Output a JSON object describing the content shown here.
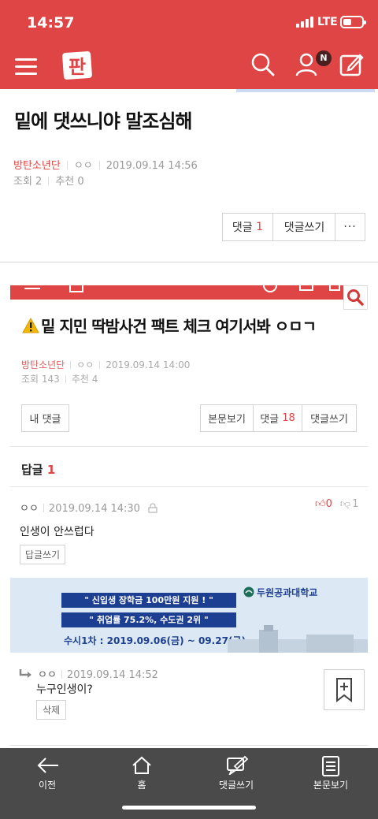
{
  "status_bar": {
    "time": "14:57",
    "network": "LTE"
  },
  "header": {
    "logo_text": "판",
    "notification_badge": "N"
  },
  "post": {
    "title": "밑에 댓쓰니야 말조심해",
    "author": "방탄소년단",
    "nickname": "ㅇㅇ",
    "datetime": "2019.09.14 14:56",
    "views": "조회 2",
    "recommends": "추천 0",
    "comment_label": "댓글",
    "comment_count": "1",
    "write_comment_label": "댓글쓰기",
    "more_label": "···"
  },
  "embedded": {
    "title": "밑 지민 딱밤사건 팩트 체크 여기서봐 ㅇㅁㄱ",
    "author": "방탄소년단",
    "nickname": "ㅇㅇ",
    "datetime": "2019.09.14 14:00",
    "views": "조회 143",
    "recommends": "추천 4",
    "my_comments_label": "내 댓글",
    "view_post_label": "본문보기",
    "comment_label": "댓글",
    "comment_count": "18",
    "write_comment_label": "댓글쓰기",
    "replies_label": "답글",
    "replies_count": "1",
    "comment1": {
      "nickname": "ㅇㅇ",
      "datetime": "2019.09.14 14:30",
      "text": "인생이 안쓰럽다",
      "up": "0",
      "down": "1",
      "reply_button": "답글쓰기"
    },
    "ad": {
      "line1": "\" 신입생  장학금 100만원 지원 ! \"",
      "line2": "\" 취업률 75.2%, 수도권 2위 \"",
      "line3": "수시1차 : 2019.09.06(금) ~ 09.27(금)",
      "school": "두원공과대학교"
    },
    "comment2": {
      "nickname": "ㅇㅇ",
      "datetime": "2019.09.14 14:52",
      "text": "누구인생이?",
      "delete_button": "삭제"
    }
  },
  "bottom_nav": {
    "prev": "이전",
    "home": "홈",
    "write_comment": "댓글쓰기",
    "view_post": "본문보기"
  },
  "colors": {
    "brand": "#e04545",
    "nav_bg": "#4a4a4a",
    "ad_blue": "#1d3f92"
  }
}
